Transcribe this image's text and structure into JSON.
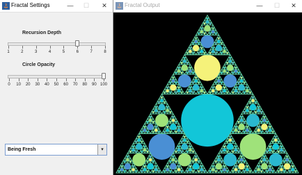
{
  "settings_window": {
    "title": "Fractal Settings",
    "controls": {
      "minimize": "—",
      "maximize": "☐",
      "close": "✕"
    },
    "depth_slider": {
      "label": "Recursion Depth",
      "min": 1,
      "max": 8,
      "value": 6,
      "tick_labels": [
        "1",
        "2",
        "3",
        "4",
        "5",
        "6",
        "7",
        "8"
      ]
    },
    "opacity_slider": {
      "label": "Circle Opacity",
      "min": 0,
      "max": 100,
      "value": 100,
      "tick_labels": [
        "0",
        "10",
        "20",
        "30",
        "40",
        "50",
        "60",
        "70",
        "80",
        "90",
        "100"
      ]
    },
    "color_mode": {
      "selected": "Being Fresh",
      "arrow": "▾"
    }
  },
  "output_window": {
    "title": "Fractal Output",
    "controls": {
      "minimize": "—",
      "maximize": "☐",
      "close": "✕"
    },
    "colors": {
      "background": "#000000",
      "edge": "#5fc9a0",
      "palette": [
        "#12c6d8",
        "#f5f27a",
        "#4a8fd4",
        "#9fe27a",
        "#2ab8d0"
      ]
    }
  }
}
